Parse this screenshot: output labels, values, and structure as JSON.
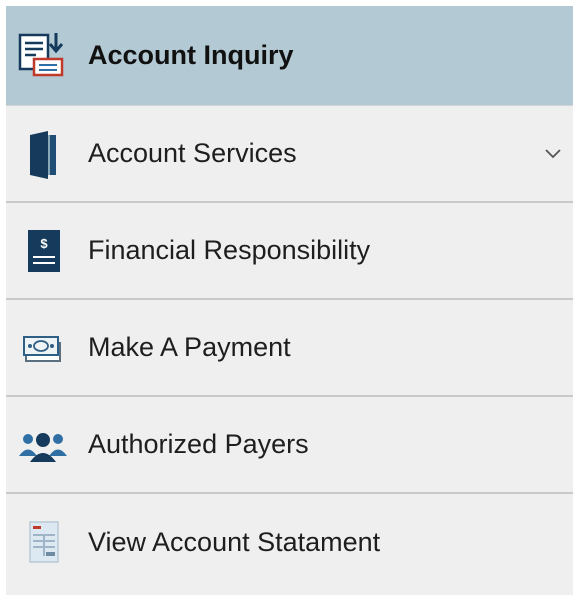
{
  "menu": {
    "items": [
      {
        "label": "Account Inquiry",
        "icon": "account-inquiry-icon",
        "active": true
      },
      {
        "label": "Account Services",
        "icon": "door-icon",
        "has_submenu": true
      },
      {
        "label": "Financial Responsibility",
        "icon": "dollar-document-icon"
      },
      {
        "label": "Make A Payment",
        "icon": "cash-payment-icon"
      },
      {
        "label": "Authorized Payers",
        "icon": "people-group-icon"
      },
      {
        "label": "View Account Statament",
        "icon": "statement-icon"
      }
    ]
  },
  "colors": {
    "active_background": "#b3c9d4",
    "item_background": "#efefef",
    "divider": "#c9c9c9",
    "icon_navy": "#153a5b",
    "icon_blue": "#2f6fa3",
    "icon_red": "#c0392b"
  }
}
